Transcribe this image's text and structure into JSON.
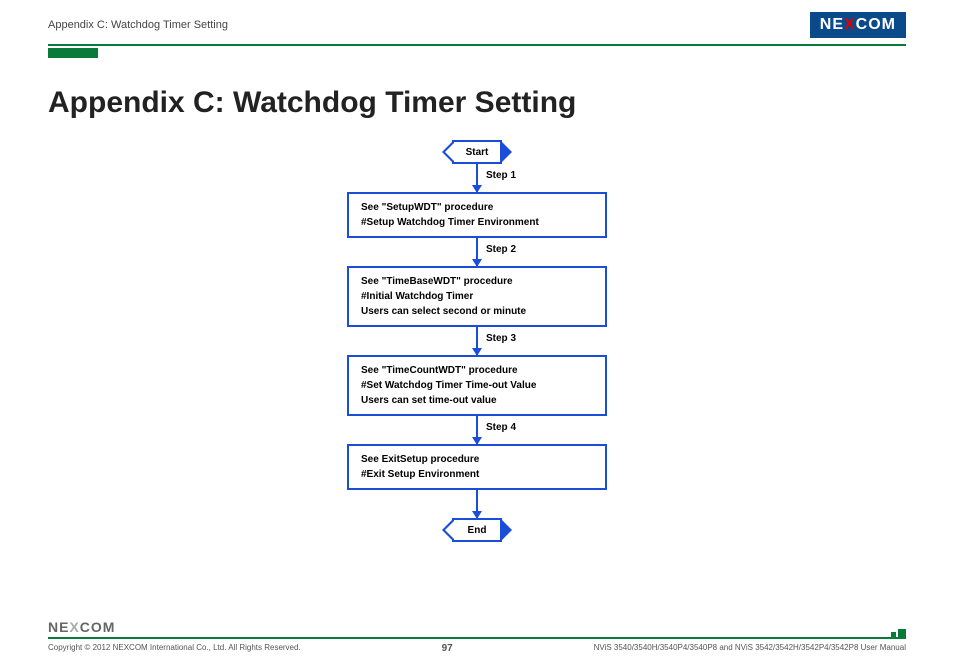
{
  "header": {
    "breadcrumb": "Appendix C: Watchdog Timer Setting",
    "logo_text_1": "NE",
    "logo_text_x": "X",
    "logo_text_2": "COM"
  },
  "title": "Appendix C: Watchdog Timer Setting",
  "chart_data": {
    "type": "flowchart",
    "start": "Start",
    "end": "End",
    "steps": [
      {
        "label": "Step 1",
        "lines": [
          "See \"SetupWDT\" procedure",
          "#Setup Watchdog Timer Environment"
        ]
      },
      {
        "label": "Step 2",
        "lines": [
          "See \"TimeBaseWDT\" procedure",
          "#Initial Watchdog Timer",
          "Users can select second or minute"
        ]
      },
      {
        "label": "Step 3",
        "lines": [
          "See \"TimeCountWDT\" procedure",
          "#Set Watchdog Timer Time-out Value",
          "Users can set time-out value"
        ]
      },
      {
        "label": "Step 4",
        "lines": [
          "See ExitSetup procedure",
          "#Exit Setup Environment"
        ]
      }
    ]
  },
  "footer": {
    "logo_1": "NE",
    "logo_x": "X",
    "logo_2": "COM",
    "copyright": "Copyright © 2012 NEXCOM International Co., Ltd. All Rights Reserved.",
    "page": "97",
    "doc": "NViS 3540/3540H/3540P4/3540P8 and NViS 3542/3542H/3542P4/3542P8 User Manual"
  }
}
